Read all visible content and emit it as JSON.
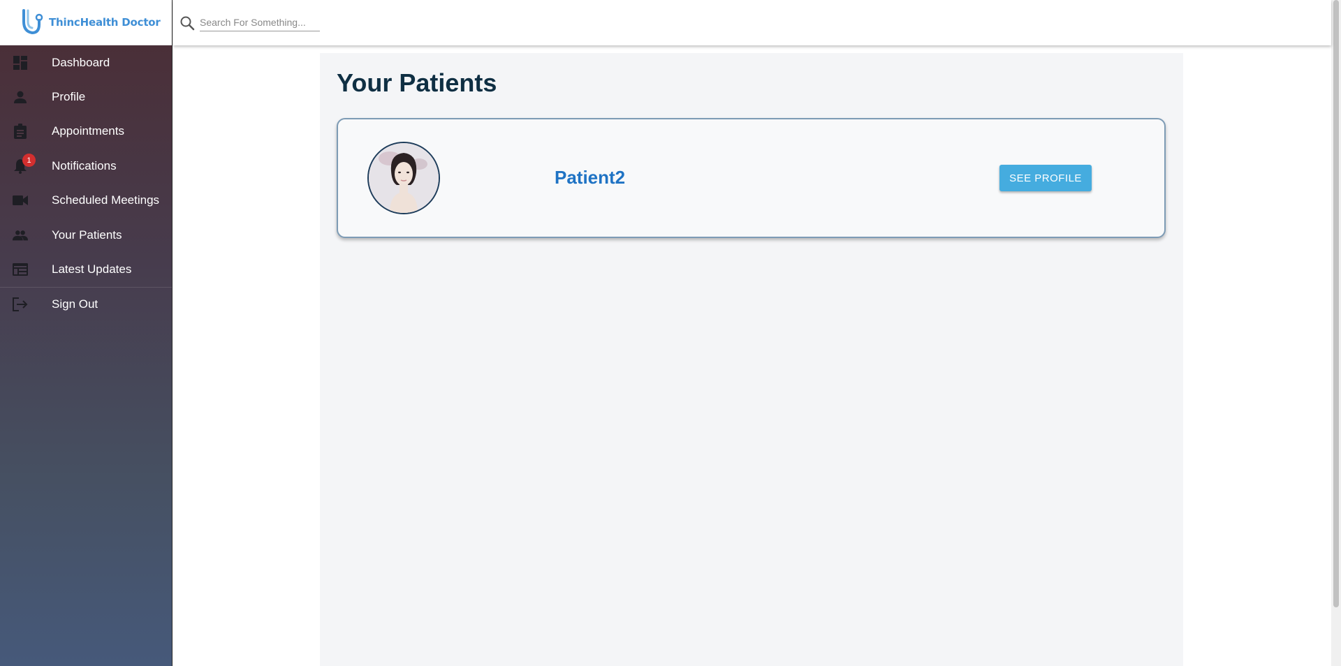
{
  "app": {
    "logo_text": "ThincHealth Doctor"
  },
  "sidebar": {
    "items": [
      {
        "label": "Dashboard",
        "icon": "dashboard-icon"
      },
      {
        "label": "Profile",
        "icon": "person-icon"
      },
      {
        "label": "Appointments",
        "icon": "clipboard-icon"
      },
      {
        "label": "Notifications",
        "icon": "bell-icon",
        "badge": "1"
      },
      {
        "label": "Scheduled Meetings",
        "icon": "video-camera-icon"
      },
      {
        "label": "Your Patients",
        "icon": "people-icon"
      },
      {
        "label": "Latest Updates",
        "icon": "table-icon"
      },
      {
        "label": "Sign Out",
        "icon": "sign-out-icon"
      }
    ]
  },
  "search": {
    "placeholder": "Search For Something..."
  },
  "main": {
    "title": "Your Patients",
    "patients": [
      {
        "name": "Patient2",
        "button_label": "SEE PROFILE"
      }
    ]
  },
  "colors": {
    "accent": "#45acdf",
    "title": "#0f2f43",
    "patient_name": "#1f73c4",
    "badge": "#d32f2f",
    "logo": "#3f8fd6"
  }
}
